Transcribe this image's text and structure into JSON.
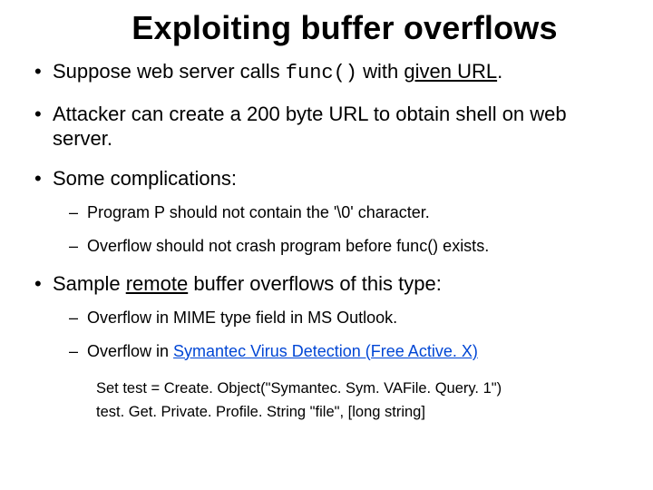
{
  "title": "Exploiting buffer overflows",
  "b1_a": "Suppose web server calls ",
  "b1_func": "func()",
  "b1_b": " with ",
  "b1_given": "given URL",
  "b1_c": ".",
  "b2": "Attacker can create a 200 byte URL to obtain shell on web server.",
  "b3": "Some complications:",
  "b3s1": "Program  P  should not contain the  '\\0'  character.",
  "b3s2": "Overflow should not crash program before  func()  exists.",
  "b4_a": "Sample ",
  "b4_remote": "remote",
  "b4_b": " buffer overflows of this type:",
  "b4s1": "Overflow in MIME type field in MS Outlook.",
  "b4s2_a": "Overflow in ",
  "b4s2_link": "Symantec Virus Detection (Free Active. X)",
  "code1": "Set test = Create. Object(\"Symantec. Sym. VAFile. Query. 1\")",
  "code2": "test. Get. Private. Profile. String  \"file\",  [long string]"
}
